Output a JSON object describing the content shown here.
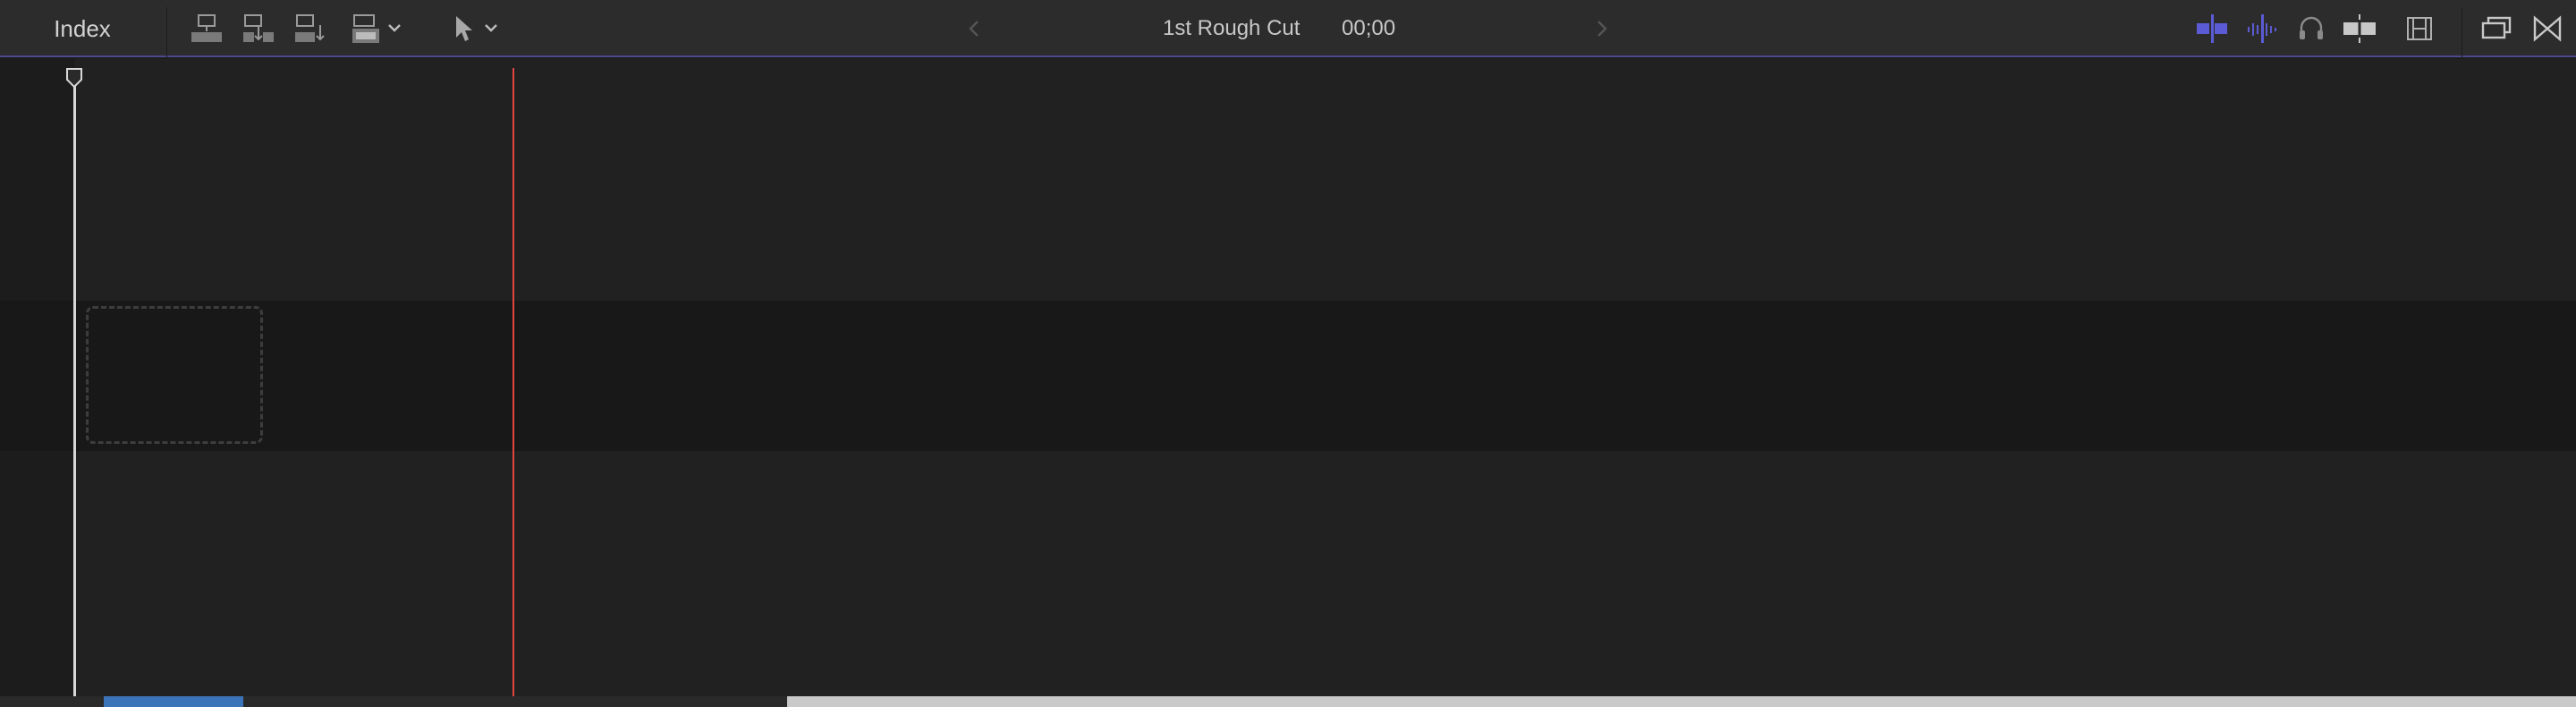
{
  "toolbar": {
    "index_label": "Index",
    "project_title": "1st Rough Cut",
    "timecode": "00;00"
  },
  "icons": {
    "connect": "connect-clip-icon",
    "insert": "insert-clip-icon",
    "append": "append-clip-icon",
    "overwrite": "overwrite-clip-icon",
    "select_tool": "arrow-select-tool-icon",
    "back": "chevron-left-icon",
    "forward": "chevron-right-icon",
    "snapping": "snapping-icon",
    "skimming": "audio-skimming-icon",
    "solo": "headphones-solo-icon",
    "clip_skimming": "clip-skimming-icon",
    "appearance": "clip-appearance-icon",
    "timeline_index": "timeline-history-icon",
    "close": "bowtie-close-icon"
  },
  "colors": {
    "accent": "#5b5bd6",
    "playhead": "#e0463e",
    "toolbar_bg": "#2c2c2c",
    "timeline_bg": "#212121"
  }
}
